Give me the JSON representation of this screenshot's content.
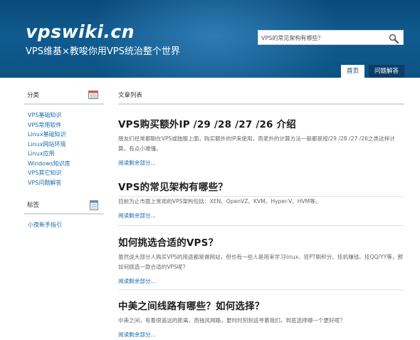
{
  "header": {
    "logo": "vpswiki.cn",
    "tagline": "VPS维基×教唆你用VPS统治整个世界",
    "search_value": "VPS的常见架构有哪些？",
    "tabs": [
      "首页",
      "问题解答"
    ]
  },
  "sidebar": {
    "categories_title": "分类",
    "categories": [
      "VPS基础知识",
      "VPS常用软件",
      "Linux基础知识",
      "Linux网站环境",
      "Linux应用",
      "Windows知识库",
      "VPS其它知识",
      "VPS问题解答"
    ],
    "tags_title": "标签",
    "tags": [
      "小夜新手指引"
    ]
  },
  "main": {
    "section_title": "文章列表",
    "read_more": "阅读剩余部分...",
    "posts": [
      {
        "title": "VPS购买额外IP /29 /28 /27 /26 介绍",
        "excerpt": "朋友们经常都聊在VPS或独服上面，购买额外的IP来使用，而老外的计算方法一般都是按/29 /28 /27 /26之类这样计算，有点小难懂。"
      },
      {
        "title": "VPS的常见架构有哪些？",
        "excerpt": "目前为止市面上常用的VPS架构包括：XEN、OpenVZ、KVM、Hyper-V、HVM等。"
      },
      {
        "title": "如何挑选合适的VPS？",
        "excerpt": "虽然说大部分人购买VPS的用途都是做网站，但也有一些人是用来学习linux、挂PT刷积分、挂机赚钱、挂QQ/YY等，那如何挑选一款合适的VPS呢？"
      },
      {
        "title": "中美之间线路有哪些？如何选择？",
        "excerpt": "中美之间，有着很遥远的距离，而抽风网路，更时时刻刻追寻着我们，到底选择哪一个更好呢？"
      }
    ]
  }
}
